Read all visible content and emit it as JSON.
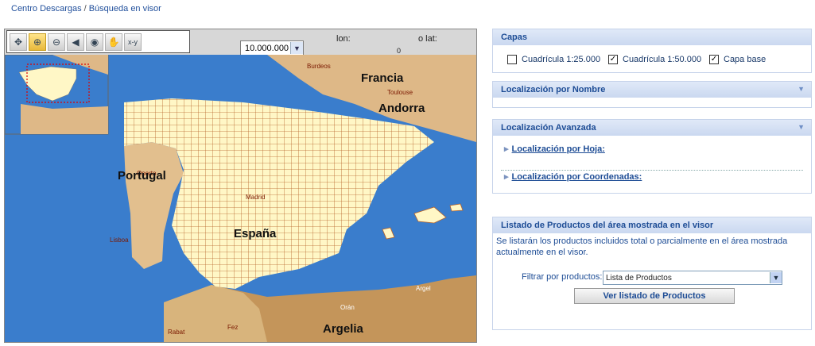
{
  "breadcrumb": {
    "root": "Centro Descargas",
    "sep": "/",
    "current": "Búsqueda en visor"
  },
  "toolbar": {
    "tools": [
      {
        "icon": "pan-icon",
        "glyph": "✥"
      },
      {
        "icon": "zoom-in-icon",
        "glyph": "⊕"
      },
      {
        "icon": "zoom-out-icon",
        "glyph": "⊖"
      },
      {
        "icon": "previous-view-icon",
        "glyph": "◀"
      },
      {
        "icon": "full-extent-icon",
        "glyph": "◉"
      },
      {
        "icon": "hand-icon",
        "glyph": "✋"
      },
      {
        "icon": "xy-icon",
        "glyph": "⌖"
      }
    ]
  },
  "viewer": {
    "scale": "10.000.000",
    "lon_label": "lon:",
    "lat_label": "o lat:",
    "lat_value": "0"
  },
  "map_labels": {
    "burdeos": "Burdeos",
    "francia": "Francia",
    "toulouse": "Toulouse",
    "andorra": "Andorra",
    "oporto": "Oporto",
    "portugal": "Portugal",
    "madrid": "Madrid",
    "espana": "España",
    "lisboa": "Lisboa",
    "argel": "Argel",
    "oran": "Orán",
    "rabat": "Rabat",
    "fez": "Fez",
    "argelia": "Argelia"
  },
  "capas": {
    "title": "Capas",
    "items": [
      {
        "label": "Cuadrícula 1:25.000",
        "checked": false
      },
      {
        "label": "Cuadrícula 1:50.000",
        "checked": true
      },
      {
        "label": "Capa base",
        "checked": true
      }
    ]
  },
  "nombre": {
    "title": "Localización por Nombre"
  },
  "avanzada": {
    "title": "Localización Avanzada",
    "hoja": "Localización por Hoja:",
    "coordenadas": "Localización por Coordenadas:"
  },
  "listado": {
    "title": "Listado de Productos del área mostrada en el visor",
    "desc": "Se listarán los productos incluidos total o parcialmente en el área mostrada actualmente en el visor.",
    "filter_label": "Filtrar por productos:",
    "filter_value": "Lista de Productos",
    "button": "Ver listado de Productos"
  },
  "colors": {
    "sea": "#3a7dcc",
    "land": "#deb887",
    "spain": "#fff7c6",
    "grid": "#b8642a",
    "panel_header": "#cad8f0",
    "link": "#1d4c95"
  }
}
